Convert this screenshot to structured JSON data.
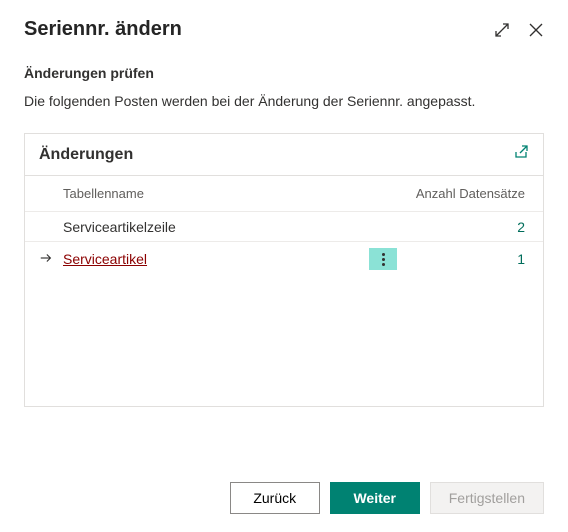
{
  "dialog": {
    "title": "Seriennr. ändern"
  },
  "content": {
    "subtitle": "Änderungen prüfen",
    "description": "Die folgenden Posten werden bei der Änderung der Seriennr. angepasst."
  },
  "panel": {
    "title": "Änderungen",
    "columns": {
      "name": "Tabellenname",
      "count": "Anzahl Datensätze"
    },
    "rows": [
      {
        "name": "Serviceartikelzeile",
        "count": "2",
        "selected": false
      },
      {
        "name": "Serviceartikel",
        "count": "1",
        "selected": true
      }
    ]
  },
  "footer": {
    "back": "Zurück",
    "next": "Weiter",
    "finish": "Fertigstellen"
  }
}
